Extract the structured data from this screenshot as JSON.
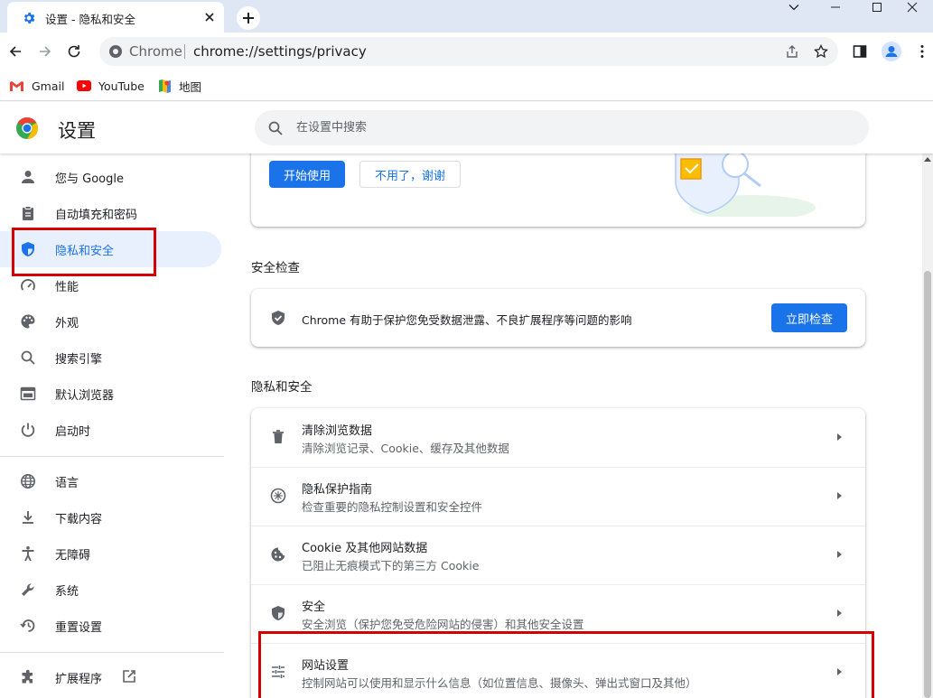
{
  "tab": {
    "title": "设置 - 隐私和安全"
  },
  "toolbar": {
    "site_name": "Chrome",
    "url": "chrome://settings/privacy"
  },
  "bookmarks": [
    {
      "label": "Gmail"
    },
    {
      "label": "YouTube"
    },
    {
      "label": "地图"
    }
  ],
  "header": {
    "title": "设置",
    "search_placeholder": "在设置中搜索"
  },
  "sidebar": {
    "items": [
      {
        "label": "您与 Google",
        "icon": "person-icon"
      },
      {
        "label": "自动填充和密码",
        "icon": "clipboard-icon"
      },
      {
        "label": "隐私和安全",
        "icon": "shield-icon",
        "active": true
      },
      {
        "label": "性能",
        "icon": "speedometer-icon"
      },
      {
        "label": "外观",
        "icon": "palette-icon"
      },
      {
        "label": "搜索引擎",
        "icon": "search-icon"
      },
      {
        "label": "默认浏览器",
        "icon": "browser-window-icon"
      },
      {
        "label": "启动时",
        "icon": "power-icon"
      },
      {
        "label": "语言",
        "icon": "globe-icon"
      },
      {
        "label": "下载内容",
        "icon": "download-icon"
      },
      {
        "label": "无障碍",
        "icon": "accessibility-icon"
      },
      {
        "label": "系统",
        "icon": "wrench-icon"
      },
      {
        "label": "重置设置",
        "icon": "restore-icon"
      },
      {
        "label": "扩展程序",
        "icon": "puzzle-icon"
      }
    ]
  },
  "promo": {
    "start_label": "开始使用",
    "decline_label": "不用了，谢谢"
  },
  "safety_check": {
    "section_title": "安全检查",
    "description": "Chrome 有助于保护您免受数据泄露、不良扩展程序等问题的影响",
    "check_label": "立即检查"
  },
  "privacy": {
    "section_title": "隐私和安全",
    "rows": [
      {
        "title": "清除浏览数据",
        "subtitle": "清除浏览记录、Cookie、缓存及其他数据",
        "icon": "trash-icon"
      },
      {
        "title": "隐私保护指南",
        "subtitle": "检查重要的隐私控制设置和安全控件",
        "icon": "compass-icon"
      },
      {
        "title": "Cookie 及其他网站数据",
        "subtitle": "已阻止无痕模式下的第三方 Cookie",
        "icon": "cookie-icon"
      },
      {
        "title": "安全",
        "subtitle": "安全浏览（保护您免受危险网站的侵害）和其他安全设置",
        "icon": "shield-icon"
      },
      {
        "title": "网站设置",
        "subtitle": "控制网站可以使用和显示什么信息（如位置信息、摄像头、弹出式窗口及其他）",
        "icon": "sliders-icon"
      }
    ]
  },
  "colors": {
    "accent": "#1a73e8",
    "highlight": "#d40000",
    "active_bg": "#e8f0fe"
  }
}
